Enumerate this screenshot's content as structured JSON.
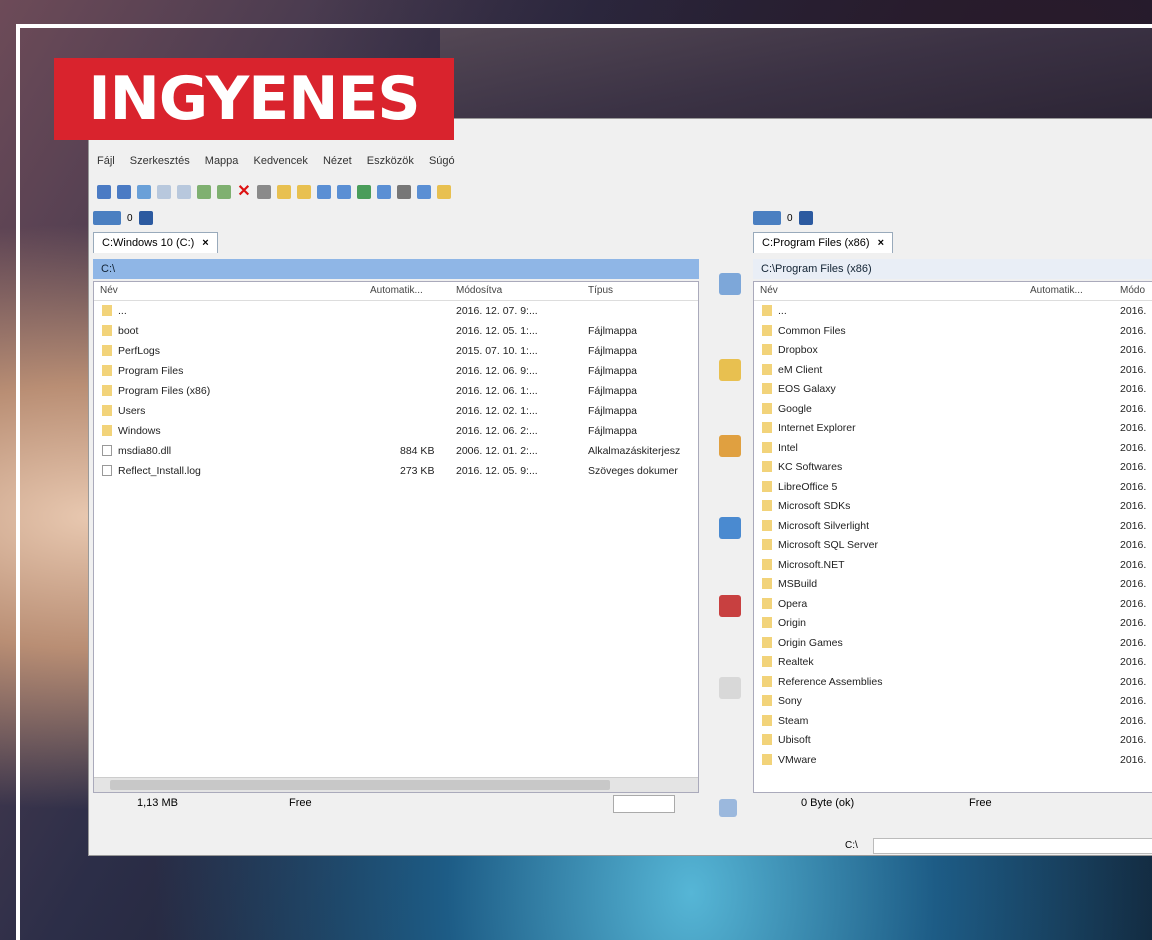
{
  "badge": "INGYENES",
  "menu": [
    "Fájl",
    "Szerkesztés",
    "Mappa",
    "Kedvencek",
    "Nézet",
    "Eszközök",
    "Súgó"
  ],
  "left": {
    "drives_label": "0",
    "tab": "C:Windows 10 (C:)",
    "path": "C:\\",
    "columns": {
      "name": "Név",
      "auto": "Automatik...",
      "modified": "Módosítva",
      "type": "Típus"
    },
    "rows": [
      {
        "name": "...",
        "auto": "",
        "modified": "2016. 12. 07. 9:...",
        "type": "",
        "kind": "up"
      },
      {
        "name": "boot",
        "auto": "",
        "modified": "2016. 12. 05. 1:...",
        "type": "Fájlmappa",
        "kind": "folder"
      },
      {
        "name": "PerfLogs",
        "auto": "",
        "modified": "2015. 07. 10. 1:...",
        "type": "Fájlmappa",
        "kind": "folder"
      },
      {
        "name": "Program Files",
        "auto": "",
        "modified": "2016. 12. 06. 9:...",
        "type": "Fájlmappa",
        "kind": "folder"
      },
      {
        "name": "Program Files (x86)",
        "auto": "",
        "modified": "2016. 12. 06. 1:...",
        "type": "Fájlmappa",
        "kind": "folder"
      },
      {
        "name": "Users",
        "auto": "",
        "modified": "2016. 12. 02. 1:...",
        "type": "Fájlmappa",
        "kind": "folder"
      },
      {
        "name": "Windows",
        "auto": "",
        "modified": "2016. 12. 06. 2:...",
        "type": "Fájlmappa",
        "kind": "folder"
      },
      {
        "name": "msdia80.dll",
        "auto": "884 KB",
        "modified": "2006. 12. 01. 2:...",
        "type": "Alkalmazáskiterjesz",
        "kind": "file"
      },
      {
        "name": "Reflect_Install.log",
        "auto": "273 KB",
        "modified": "2016. 12. 05. 9:...",
        "type": "Szöveges dokumer",
        "kind": "file"
      }
    ],
    "status_size": "1,13 MB",
    "status_free": "Free"
  },
  "right": {
    "drives_label": "0",
    "tab": "C:Program Files (x86)",
    "path": "C:\\Program Files (x86)",
    "columns": {
      "name": "Név",
      "auto": "Automatik...",
      "modified": "Módo"
    },
    "rows": [
      {
        "name": "...",
        "modified": "2016."
      },
      {
        "name": "Common Files",
        "modified": "2016."
      },
      {
        "name": "Dropbox",
        "modified": "2016."
      },
      {
        "name": "eM Client",
        "modified": "2016."
      },
      {
        "name": "EOS Galaxy",
        "modified": "2016."
      },
      {
        "name": "Google",
        "modified": "2016."
      },
      {
        "name": "Internet Explorer",
        "modified": "2016."
      },
      {
        "name": "Intel",
        "modified": "2016."
      },
      {
        "name": "KC Softwares",
        "modified": "2016."
      },
      {
        "name": "LibreOffice 5",
        "modified": "2016."
      },
      {
        "name": "Microsoft SDKs",
        "modified": "2016."
      },
      {
        "name": "Microsoft Silverlight",
        "modified": "2016."
      },
      {
        "name": "Microsoft SQL Server",
        "modified": "2016."
      },
      {
        "name": "Microsoft.NET",
        "modified": "2016."
      },
      {
        "name": "MSBuild",
        "modified": "2016."
      },
      {
        "name": "Opera",
        "modified": "2016."
      },
      {
        "name": "Origin",
        "modified": "2016."
      },
      {
        "name": "Origin Games",
        "modified": "2016."
      },
      {
        "name": "Realtek",
        "modified": "2016."
      },
      {
        "name": "Reference Assemblies",
        "modified": "2016."
      },
      {
        "name": "Sony",
        "modified": "2016."
      },
      {
        "name": "Steam",
        "modified": "2016."
      },
      {
        "name": "Ubisoft",
        "modified": "2016."
      },
      {
        "name": "VMware",
        "modified": "2016."
      }
    ],
    "status_size": "0 Byte (ok)",
    "status_free": "Free"
  },
  "bottom_path": "C:\\"
}
